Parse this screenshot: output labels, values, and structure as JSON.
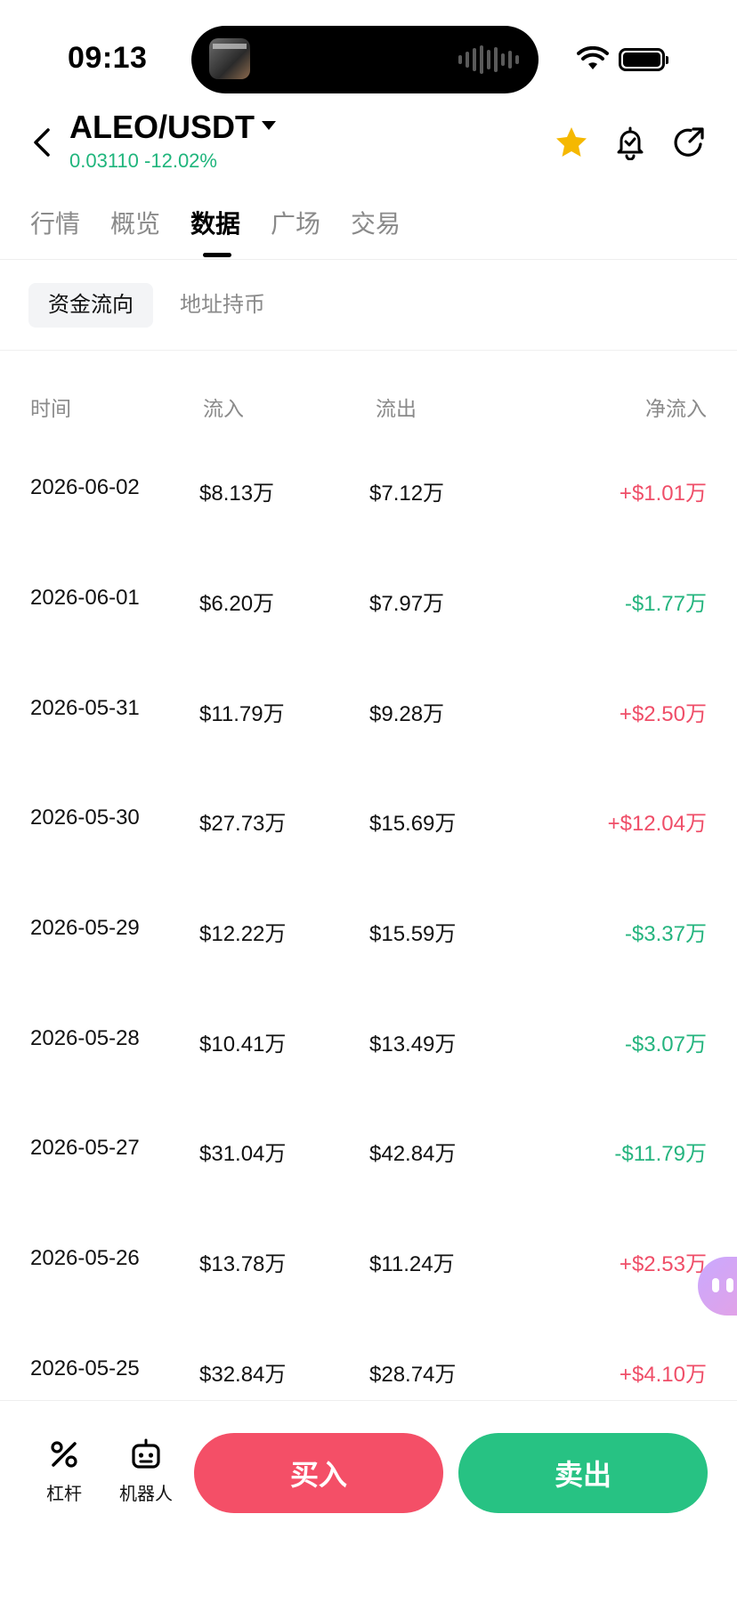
{
  "status_bar": {
    "time": "09:13"
  },
  "header": {
    "pair": "ALEO/USDT",
    "price": "0.03110",
    "change": "-12.02%"
  },
  "tabs": [
    "行情",
    "概览",
    "数据",
    "广场",
    "交易"
  ],
  "active_tab": "数据",
  "subtabs": [
    "资金流向",
    "地址持币"
  ],
  "table": {
    "headers": [
      "时间",
      "流入",
      "流出",
      "净流入"
    ],
    "rows": [
      {
        "date": "2026-06-02",
        "inflow": "$8.13万",
        "outflow": "$7.12万",
        "net": "+$1.01万"
      },
      {
        "date": "2026-06-01",
        "inflow": "$6.20万",
        "outflow": "$7.97万",
        "net": "-$1.77万"
      },
      {
        "date": "2026-05-31",
        "inflow": "$11.79万",
        "outflow": "$9.28万",
        "net": "+$2.50万"
      },
      {
        "date": "2026-05-30",
        "inflow": "$27.73万",
        "outflow": "$15.69万",
        "net": "+$12.04万"
      },
      {
        "date": "2026-05-29",
        "inflow": "$12.22万",
        "outflow": "$15.59万",
        "net": "-$3.37万"
      },
      {
        "date": "2026-05-28",
        "inflow": "$10.41万",
        "outflow": "$13.49万",
        "net": "-$3.07万"
      },
      {
        "date": "2026-05-27",
        "inflow": "$31.04万",
        "outflow": "$42.84万",
        "net": "-$11.79万"
      },
      {
        "date": "2026-05-26",
        "inflow": "$13.78万",
        "outflow": "$11.24万",
        "net": "+$2.53万"
      },
      {
        "date": "2026-05-25",
        "inflow": "$32.84万",
        "outflow": "$28.74万",
        "net": "+$4.10万"
      }
    ]
  },
  "bottom_bar": {
    "leverage_label": "杠杆",
    "bot_label": "机器人",
    "buy_label": "买入",
    "sell_label": "卖出"
  },
  "colors": {
    "positive": "#ef4e68",
    "negative": "#24b47e",
    "buy": "#f44f67",
    "sell": "#27c283",
    "star": "#f5b800"
  },
  "icons": [
    "back-icon",
    "caret-down-icon",
    "star-icon",
    "alarm-bell-icon",
    "share-icon",
    "leverage-icon",
    "robot-icon",
    "wifi-icon",
    "battery-icon"
  ]
}
